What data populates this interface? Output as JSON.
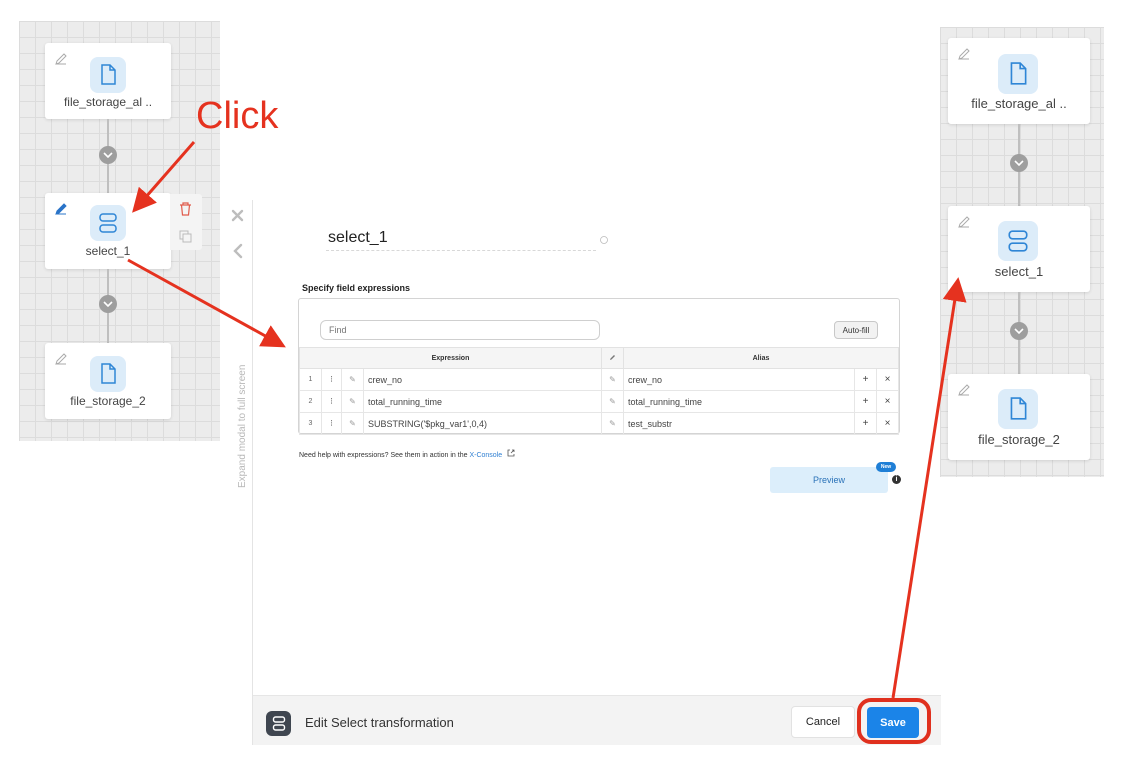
{
  "annotation": {
    "click_label": "Click",
    "arrow_color": "#e5321f"
  },
  "left_canvas": {
    "nodes": [
      {
        "label": "file_storage_al ..",
        "icon": "file-icon"
      },
      {
        "label": "select_1",
        "icon": "select-icon",
        "selected": true
      },
      {
        "label": "file_storage_2",
        "icon": "file-icon"
      }
    ]
  },
  "right_canvas": {
    "nodes": [
      {
        "label": "file_storage_al ..",
        "icon": "file-icon"
      },
      {
        "label": "select_1",
        "icon": "select-icon"
      },
      {
        "label": "file_storage_2",
        "icon": "file-icon"
      }
    ]
  },
  "modal": {
    "expand_hint": "Expand modal to full screen",
    "title": "select_1",
    "section_label": "Specify field expressions",
    "find_placeholder": "Find",
    "autofill_label": "Auto-fill",
    "columns": {
      "expression": "Expression",
      "alias": "Alias"
    },
    "rows": [
      {
        "num": "1",
        "expression": "crew_no",
        "alias": "crew_no"
      },
      {
        "num": "2",
        "expression": "total_running_time",
        "alias": "total_running_time"
      },
      {
        "num": "3",
        "expression": "SUBSTRING('$pkg_var1',0,4)",
        "alias": "test_substr"
      }
    ],
    "help_text": "Need help with expressions? See them in action in the",
    "help_link": "X-Console",
    "preview_label": "Preview",
    "new_badge": "New",
    "info_glyph": "i"
  },
  "footer": {
    "title": "Edit Select transformation",
    "cancel_label": "Cancel",
    "save_label": "Save",
    "save_color": "#1b84e8"
  }
}
